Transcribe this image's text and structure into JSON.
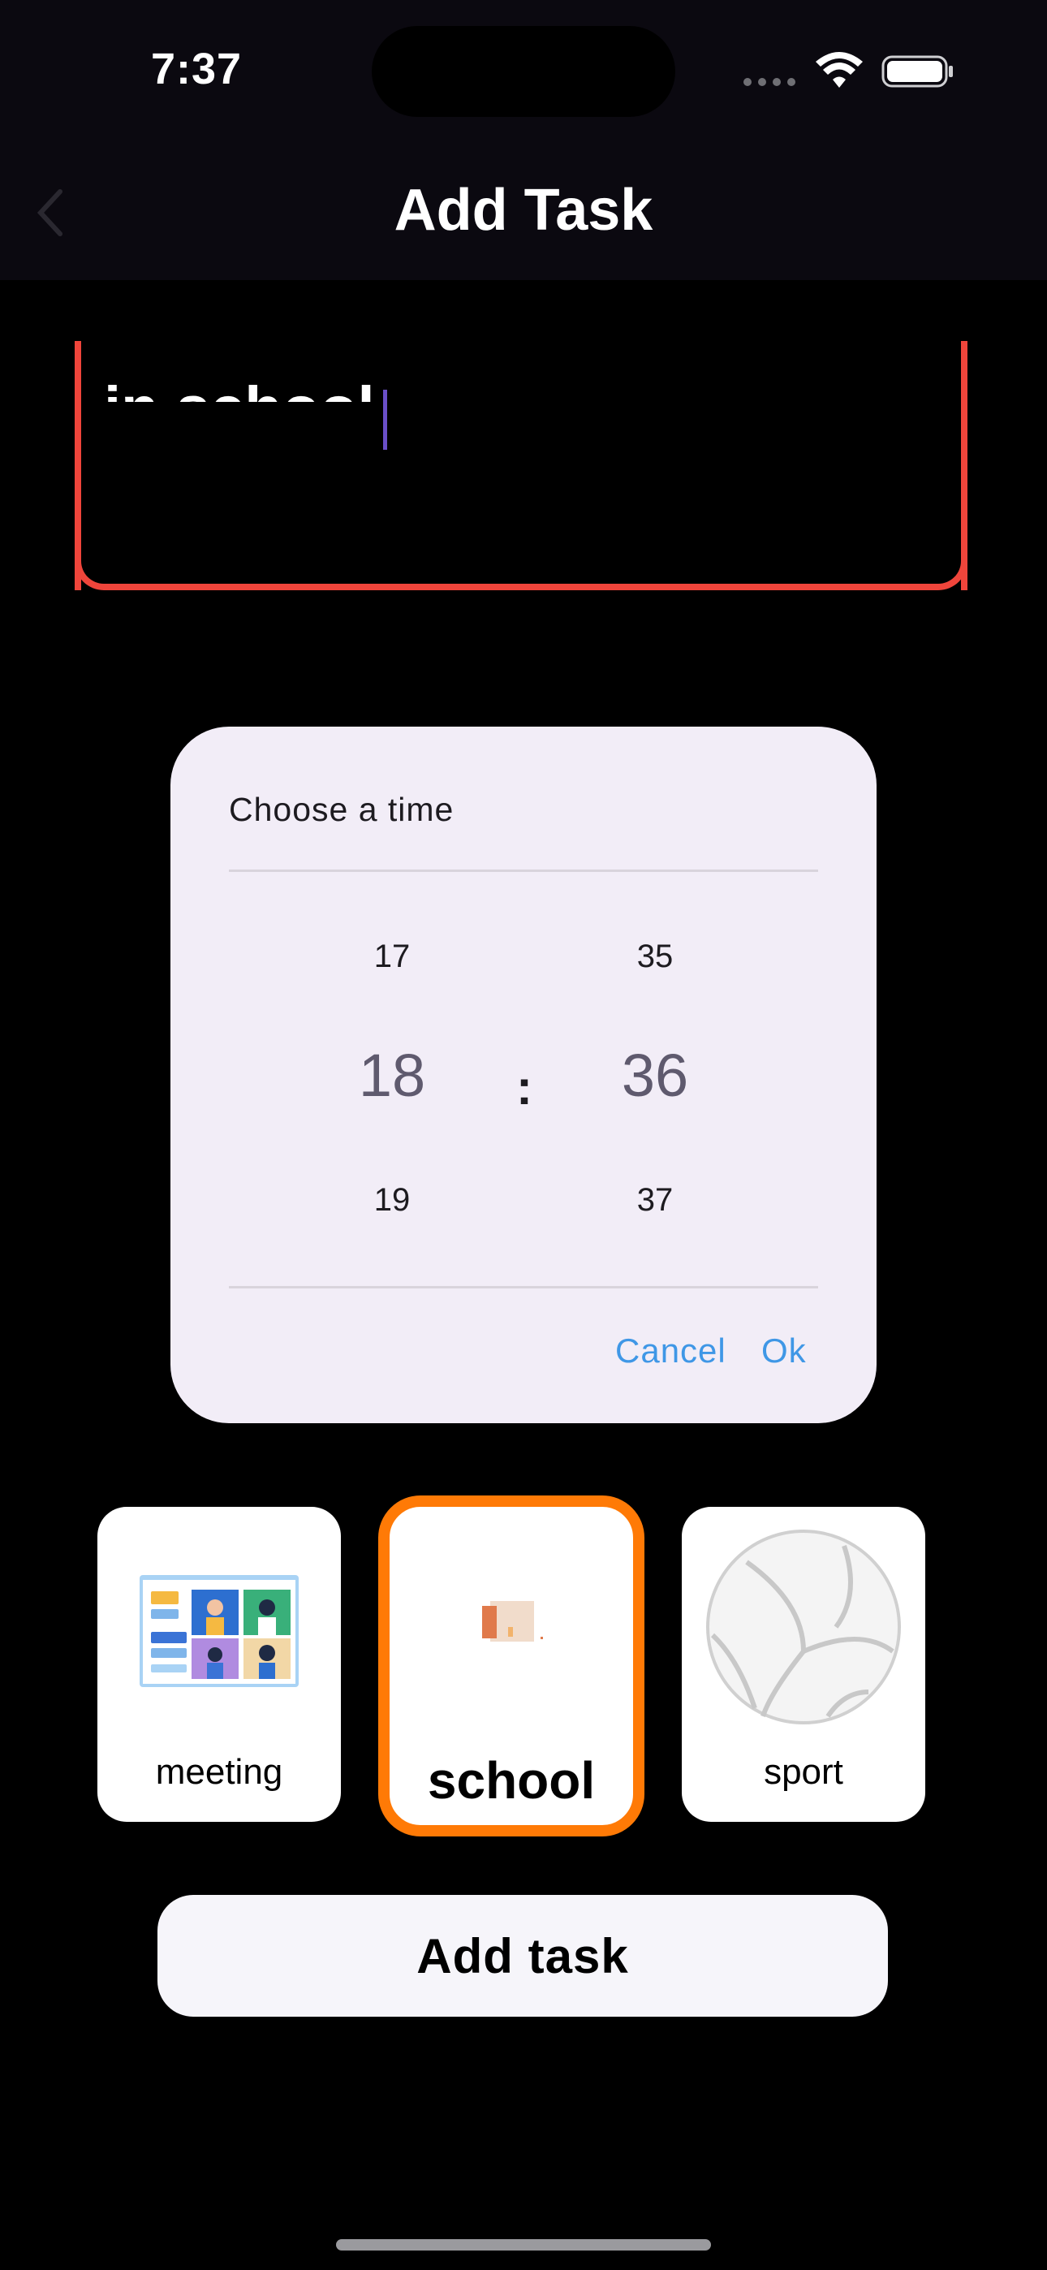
{
  "status_bar": {
    "time": "7:37"
  },
  "nav": {
    "title": "Add Task",
    "back_icon": "chevron-left-icon"
  },
  "task_input": {
    "value": "in school"
  },
  "time_dialog": {
    "title": "Choose a time",
    "hours": {
      "prev": "17",
      "selected": "18",
      "next": "19"
    },
    "separator": ":",
    "minutes": {
      "prev": "35",
      "selected": "36",
      "next": "37"
    },
    "cancel_label": "Cancel",
    "ok_label": "Ok"
  },
  "categories": [
    {
      "label": "meeting",
      "icon": "meeting-illustration-icon",
      "selected": false
    },
    {
      "label": "school",
      "icon": "school-illustration-icon",
      "selected": true
    },
    {
      "label": "sport",
      "icon": "volleyball-icon",
      "selected": false
    }
  ],
  "add_button": {
    "label": "Add task"
  },
  "colors": {
    "accent_border": "#f0453b",
    "selected_category": "#ff7a06",
    "dialog_bg": "#f2edf7",
    "dialog_buttons": "#3f97e6"
  }
}
